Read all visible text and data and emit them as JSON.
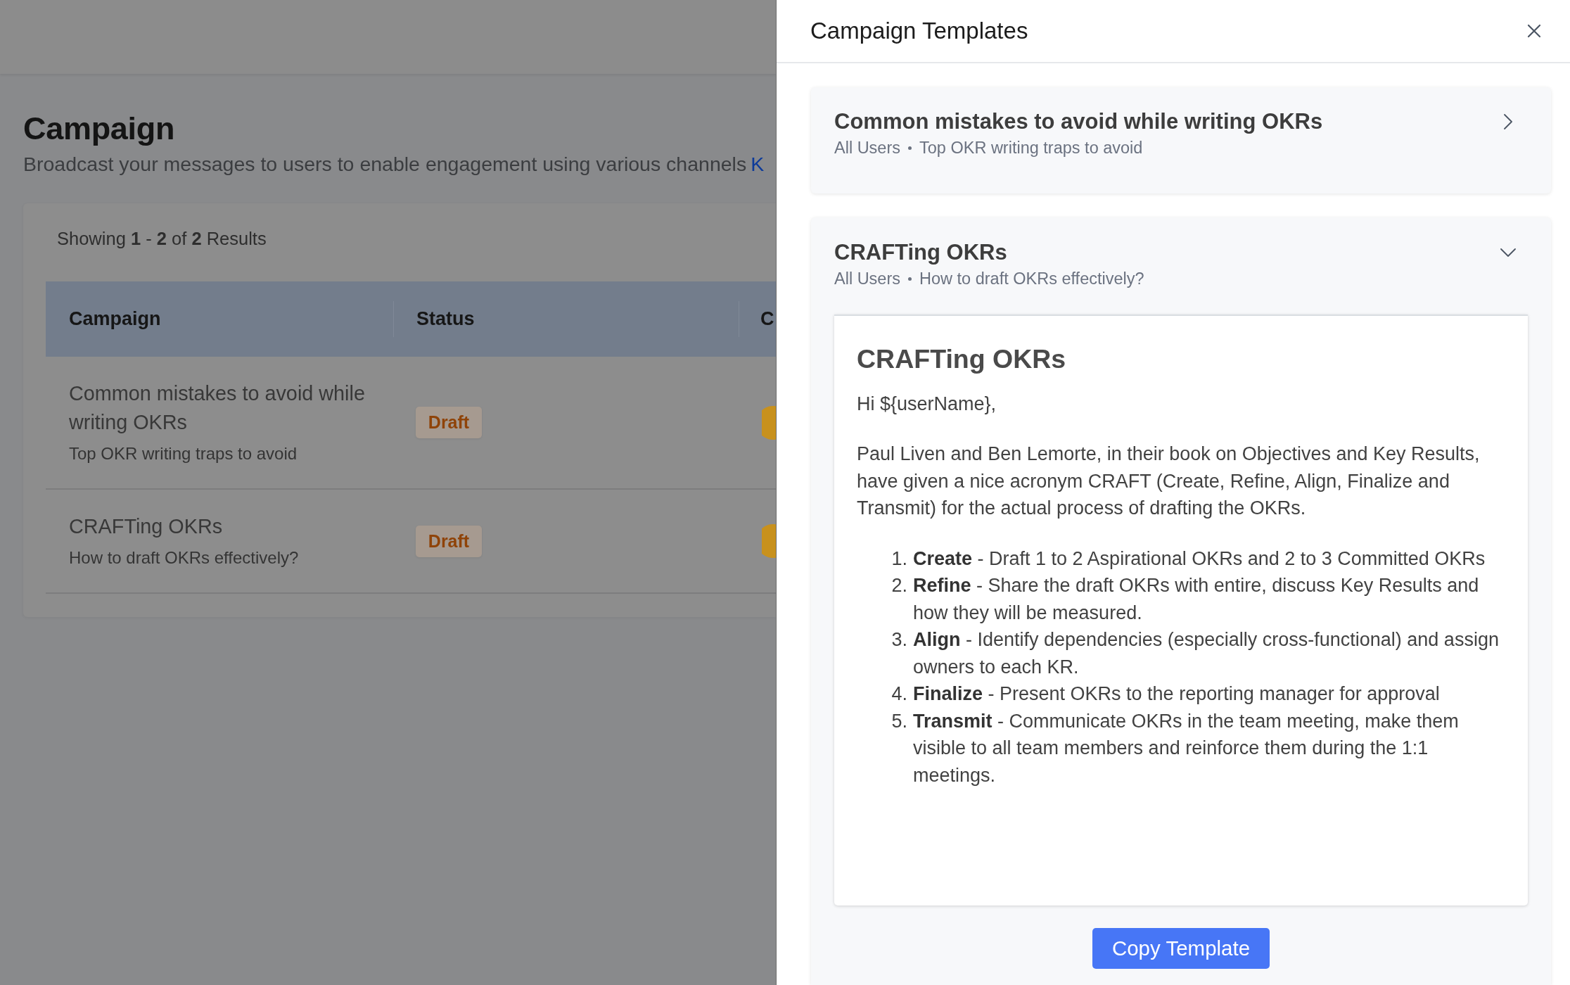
{
  "page": {
    "title": "Campaign",
    "subtitle": "Broadcast your messages to users to enable engagement using various channels",
    "subtitle_link": "K"
  },
  "results": {
    "summary": "Showing **1** - **2** of **2** Results",
    "table": {
      "columns": [
        "Campaign",
        "Status",
        "C"
      ],
      "rows": [
        {
          "title": "Common mistakes to avoid while writing OKRs",
          "description": "Top OKR writing traps to avoid",
          "status": "Draft"
        },
        {
          "title": "CRAFTing OKRs",
          "description": "How to draft OKRs effectively?",
          "status": "Draft"
        }
      ]
    }
  },
  "drawer": {
    "title": "Campaign Templates",
    "templates": [
      {
        "title": "Common mistakes to avoid while writing OKRs",
        "audience": "All Users",
        "summary": "Top OKR writing traps to avoid",
        "expanded": false
      },
      {
        "title": "CRAFTing OKRs",
        "audience": "All Users",
        "summary": "How to draft OKRs effectively?",
        "expanded": true,
        "preview": {
          "heading": "CRAFTing OKRs",
          "greeting": "Hi ${userName},",
          "paragraph": "Paul Liven and Ben Lemorte, in their book on Objectives and Key Results, have given a nice acronym CRAFT (Create, Refine, Align, Finalize and Transmit) for the actual process of drafting the OKRs.",
          "steps": [
            {
              "number": "1.",
              "text": "**Create** - Draft 1 to 2 Aspirational OKRs and 2 to 3 Committed OKRs"
            },
            {
              "number": "2.",
              "text": "**Refine** - Share the draft OKRs with entire, discuss Key Results and how they will be measured."
            },
            {
              "number": "3.",
              "text": "**Align** - Identify dependencies (especially cross-functional) and assign owners to each KR."
            },
            {
              "number": "4.",
              "text": "**Finalize** - Present OKRs to the reporting manager for approval"
            },
            {
              "number": "5.",
              "text": "**Transmit** - Communicate OKRs in the team meeting, make them visible to all team members and reinforce them during the 1:1 meetings."
            }
          ]
        },
        "action": "Copy Template"
      }
    ]
  }
}
